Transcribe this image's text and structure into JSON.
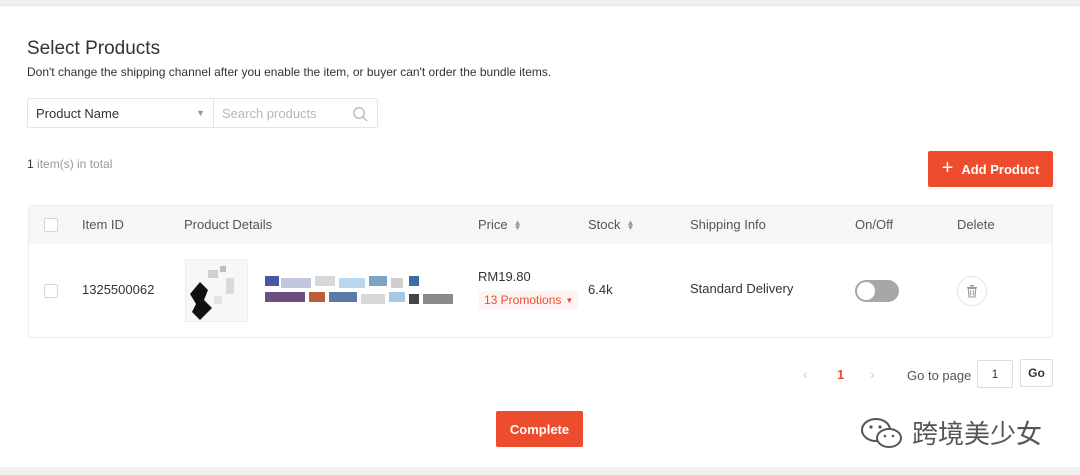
{
  "header": {
    "title": "Select Products",
    "subtitle": "Don't change the shipping channel after you enable the item, or buyer can't order the bundle items."
  },
  "filter": {
    "field_label": "Product Name",
    "search_placeholder": "Search products",
    "search_value": ""
  },
  "summary": {
    "count": "1",
    "suffix": " item(s) in total"
  },
  "add_button": {
    "label": "Add Product",
    "icon": "plus-icon"
  },
  "table": {
    "columns": {
      "item_id": "Item ID",
      "product_details": "Product Details",
      "price": "Price",
      "stock": "Stock",
      "shipping_info": "Shipping Info",
      "on_off": "On/Off",
      "delete": "Delete"
    },
    "rows": [
      {
        "item_id": "1325500062",
        "price": "RM19.80",
        "promotions": "13 Promotions",
        "stock": "6.4k",
        "shipping": "Standard Delivery",
        "enabled": false
      }
    ]
  },
  "pagination": {
    "current_page": "1",
    "goto_label": "Go to page",
    "goto_value": "1",
    "go_label": "Go"
  },
  "complete_button": {
    "label": "Complete"
  },
  "watermark": {
    "text": "跨境美少女"
  },
  "colors": {
    "accent": "#ee4d2d",
    "header_bg": "#f6f6f6",
    "toggle_off": "#a7a7a7"
  }
}
